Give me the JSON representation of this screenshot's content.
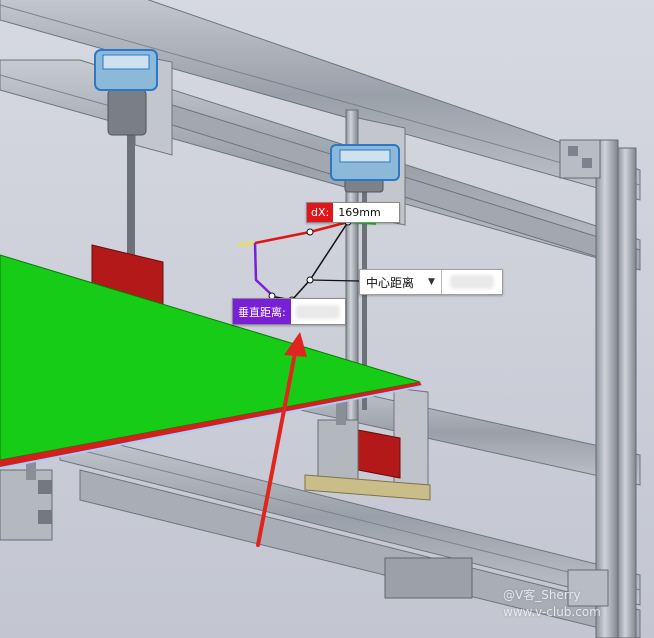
{
  "cad_view": {
    "dx_measure": {
      "label": "dX:",
      "value": "169mm"
    },
    "center_distance": {
      "option": "中心距离"
    },
    "vertical_distance": {
      "label": "垂直距离:"
    }
  },
  "watermark": {
    "line1": "@V客_Sherry",
    "line2": "www.v-club.com"
  },
  "colors": {
    "background": "#c9ccd6",
    "profile_rail": "#a8adb6",
    "green_plate": "#17cc17",
    "red_edge": "#d51f1f",
    "dx_accent": "#e0161b",
    "vertical_accent": "#7a1fd8",
    "annotation_arrow": "#e0251e"
  },
  "icons": [
    "chevron-down-icon",
    "sensor-camera-icon"
  ]
}
